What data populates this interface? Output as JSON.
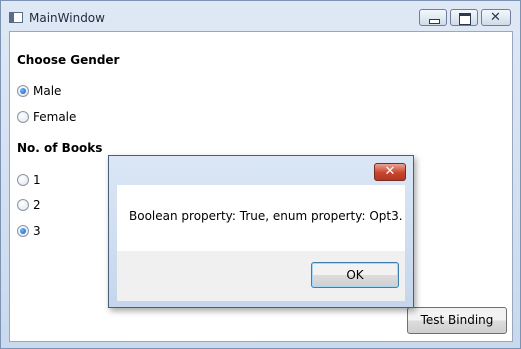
{
  "window": {
    "title": "MainWindow"
  },
  "form": {
    "gender_heading": "Choose Gender",
    "gender_options": [
      {
        "label": "Male",
        "checked": true
      },
      {
        "label": "Female",
        "checked": false
      }
    ],
    "books_heading": "No. of Books",
    "books_options": [
      {
        "label": "1",
        "checked": false
      },
      {
        "label": "2",
        "checked": false
      },
      {
        "label": "3",
        "checked": true
      }
    ],
    "test_button_label": "Test Binding"
  },
  "dialog": {
    "close_glyph": "✕",
    "message": "Boolean property: True, enum property: Opt3.",
    "ok_label": "OK"
  },
  "titlebar_glyphs": {
    "close": "✕"
  },
  "colors": {
    "radio_selected": "#1560c0",
    "dialog_close": "#c8452d"
  }
}
